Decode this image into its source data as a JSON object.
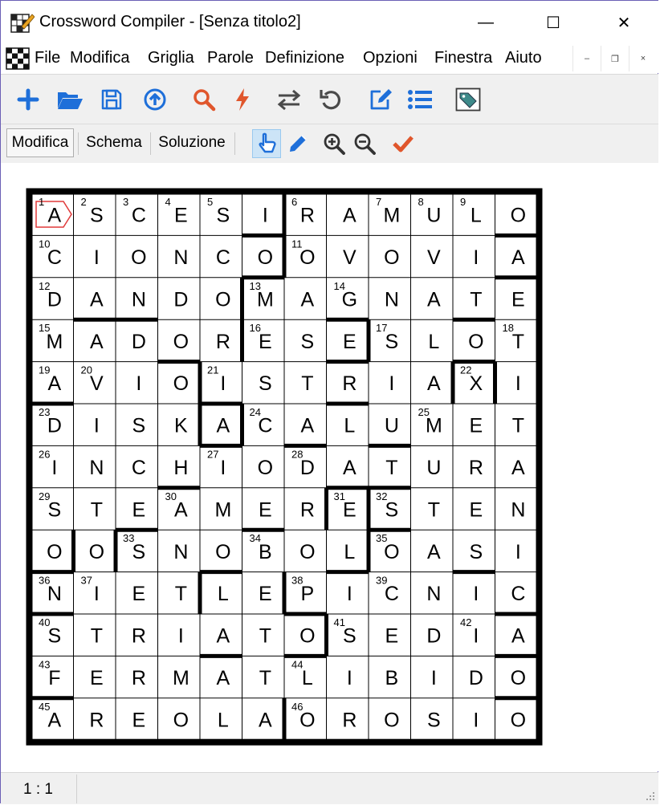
{
  "window": {
    "title": "Crossword Compiler - [Senza titolo2]",
    "minimize": "—",
    "maximize": "☐",
    "close": "✕"
  },
  "menu": {
    "items": [
      "File",
      "Modifica",
      "Griglia",
      "Parole",
      "Definizione",
      "Opzioni",
      "Finestra",
      "Aiuto"
    ],
    "mdi_minimize": "–",
    "mdi_restore": "❐",
    "mdi_close": "×"
  },
  "toolbar": {
    "icons": [
      "plus-icon",
      "folder-open-icon",
      "save-icon",
      "upload-icon",
      "search-icon",
      "lightning-icon",
      "swap-arrows-icon",
      "undo-icon",
      "edit-note-icon",
      "list-icon",
      "tag-icon"
    ],
    "accent_blue": "#1e6fd9",
    "accent_orange": "#e0562c"
  },
  "modes": {
    "tabs": [
      "Modifica",
      "Schema",
      "Soluzione"
    ],
    "active": "Modifica",
    "tool_icons": [
      "pointer-hand-icon",
      "pencil-icon",
      "zoom-in-icon",
      "zoom-out-icon",
      "checkmark-icon"
    ]
  },
  "grid": {
    "rows": 13,
    "cols": 12,
    "letters": [
      "ASCESIRAMULO",
      "CIONCOOVOVIA",
      "DANDOMAGNATE",
      "MADORESESLOT",
      "AVIOISTRIAXI",
      "DISKACALUMET",
      "INCHIODATURA",
      "STEAMERESTEN",
      "OOSNOBOLOASI",
      "NIETLEPICNIC",
      "STRIATOSEDIA",
      "FERMATLIBIDO",
      "AREOLAOROSIO"
    ],
    "numbers": [
      [
        0,
        0,
        1
      ],
      [
        0,
        1,
        2
      ],
      [
        0,
        2,
        3
      ],
      [
        0,
        3,
        4
      ],
      [
        0,
        4,
        5
      ],
      [
        0,
        6,
        6
      ],
      [
        0,
        8,
        7
      ],
      [
        0,
        9,
        8
      ],
      [
        0,
        10,
        9
      ],
      [
        1,
        0,
        10
      ],
      [
        1,
        6,
        11
      ],
      [
        2,
        0,
        12
      ],
      [
        2,
        5,
        13
      ],
      [
        2,
        7,
        14
      ],
      [
        3,
        0,
        15
      ],
      [
        3,
        5,
        16
      ],
      [
        3,
        8,
        17
      ],
      [
        3,
        11,
        18
      ],
      [
        4,
        0,
        19
      ],
      [
        4,
        1,
        20
      ],
      [
        4,
        4,
        21
      ],
      [
        4,
        10,
        22
      ],
      [
        5,
        0,
        23
      ],
      [
        5,
        5,
        24
      ],
      [
        5,
        9,
        25
      ],
      [
        6,
        0,
        26
      ],
      [
        6,
        4,
        27
      ],
      [
        6,
        6,
        28
      ],
      [
        7,
        0,
        29
      ],
      [
        7,
        3,
        30
      ],
      [
        7,
        7,
        31
      ],
      [
        7,
        8,
        32
      ],
      [
        8,
        2,
        33
      ],
      [
        8,
        5,
        34
      ],
      [
        8,
        8,
        35
      ],
      [
        9,
        0,
        36
      ],
      [
        9,
        1,
        37
      ],
      [
        9,
        6,
        38
      ],
      [
        9,
        8,
        39
      ],
      [
        10,
        0,
        40
      ],
      [
        10,
        7,
        41
      ],
      [
        10,
        10,
        42
      ],
      [
        11,
        0,
        43
      ],
      [
        11,
        6,
        44
      ],
      [
        12,
        0,
        45
      ],
      [
        12,
        6,
        46
      ]
    ],
    "selected": [
      0,
      0
    ],
    "selection_color": "#e03a3a"
  },
  "status": {
    "position": "1 : 1"
  }
}
